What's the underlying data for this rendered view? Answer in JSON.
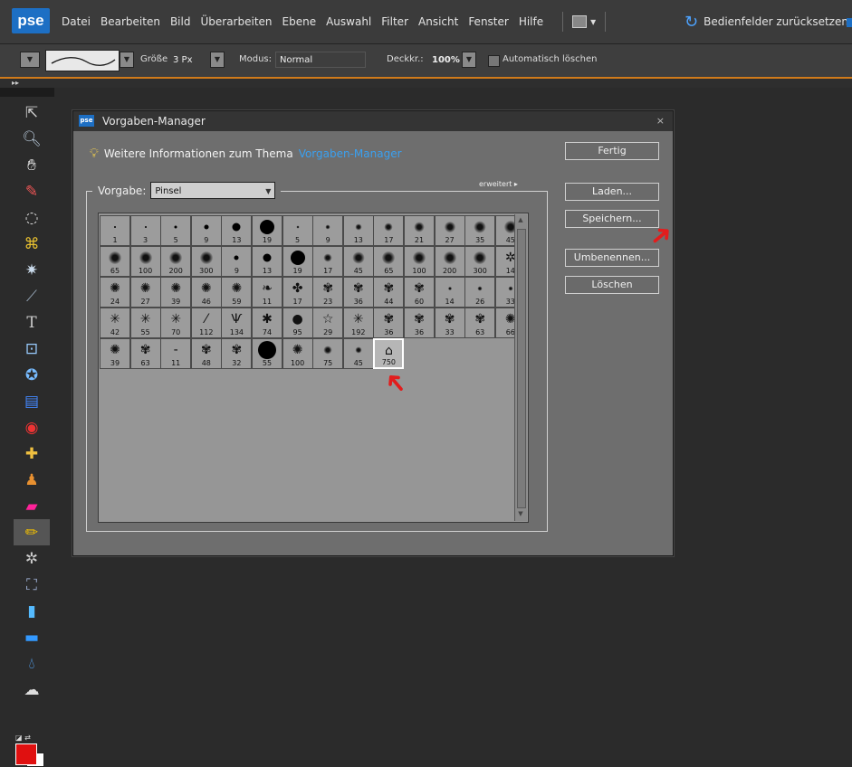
{
  "app": {
    "logo": "pse",
    "menu": [
      "Datei",
      "Bearbeiten",
      "Bild",
      "Überarbeiten",
      "Ebene",
      "Auswahl",
      "Filter",
      "Ansicht",
      "Fenster",
      "Hilfe"
    ],
    "layout_button": "▾",
    "reset_panels": "Bedienfelder zurücksetzen"
  },
  "options": {
    "size_label": "Größe:",
    "size_value": "3 Px",
    "mode_label": "Modus:",
    "mode_value": "Normal",
    "opacity_label": "Deckkr.:",
    "opacity_value": "100%",
    "auto_erase": "Automatisch löschen"
  },
  "panel_strip": {
    "tab": "▸▸"
  },
  "dialog": {
    "title": "Vorgaben-Manager",
    "logo": "pse",
    "close": "×",
    "info_text": "Weitere Informationen zum Thema",
    "info_link": "Vorgaben-Manager",
    "preset_label": "Vorgabe:",
    "preset_value": "Pinsel",
    "advanced": "erweitert ▸",
    "buttons": {
      "done": "Fertig",
      "load": "Laden...",
      "save": "Speichern...",
      "rename": "Umbenennen...",
      "delete": "Löschen"
    },
    "brushes": [
      {
        "size": "1",
        "kind": "dot",
        "d": 2
      },
      {
        "size": "3",
        "kind": "dot",
        "d": 2
      },
      {
        "size": "5",
        "kind": "dot",
        "d": 3
      },
      {
        "size": "9",
        "kind": "dot",
        "d": 5
      },
      {
        "size": "13",
        "kind": "dot",
        "d": 9
      },
      {
        "size": "19",
        "kind": "dot",
        "d": 16
      },
      {
        "size": "5",
        "kind": "soft",
        "d": 3
      },
      {
        "size": "9",
        "kind": "soft",
        "d": 5
      },
      {
        "size": "13",
        "kind": "soft",
        "d": 7
      },
      {
        "size": "17",
        "kind": "soft",
        "d": 9
      },
      {
        "size": "21",
        "kind": "soft",
        "d": 11
      },
      {
        "size": "27",
        "kind": "soft",
        "d": 12
      },
      {
        "size": "35",
        "kind": "soft",
        "d": 13
      },
      {
        "size": "45",
        "kind": "soft",
        "d": 14
      },
      {
        "size": "65",
        "kind": "soft",
        "d": 14
      },
      {
        "size": "100",
        "kind": "soft",
        "d": 14
      },
      {
        "size": "200",
        "kind": "soft",
        "d": 14
      },
      {
        "size": "300",
        "kind": "soft",
        "d": 14
      },
      {
        "size": "9",
        "kind": "dot",
        "d": 5
      },
      {
        "size": "13",
        "kind": "dot",
        "d": 9
      },
      {
        "size": "19",
        "kind": "dot",
        "d": 16
      },
      {
        "size": "17",
        "kind": "soft",
        "d": 9
      },
      {
        "size": "45",
        "kind": "soft",
        "d": 13
      },
      {
        "size": "65",
        "kind": "soft",
        "d": 14
      },
      {
        "size": "100",
        "kind": "soft",
        "d": 14
      },
      {
        "size": "200",
        "kind": "soft",
        "d": 14
      },
      {
        "size": "300",
        "kind": "soft",
        "d": 14
      },
      {
        "size": "14",
        "kind": "glyph",
        "g": "✲"
      },
      {
        "size": "24",
        "kind": "glyph",
        "g": "✺"
      },
      {
        "size": "27",
        "kind": "glyph",
        "g": "✺"
      },
      {
        "size": "39",
        "kind": "glyph",
        "g": "✺"
      },
      {
        "size": "46",
        "kind": "glyph",
        "g": "✺"
      },
      {
        "size": "59",
        "kind": "glyph",
        "g": "✺"
      },
      {
        "size": "11",
        "kind": "glyph",
        "g": "❧"
      },
      {
        "size": "17",
        "kind": "glyph",
        "g": "✤"
      },
      {
        "size": "23",
        "kind": "glyph",
        "g": "✾"
      },
      {
        "size": "36",
        "kind": "glyph",
        "g": "✾"
      },
      {
        "size": "44",
        "kind": "glyph",
        "g": "✾"
      },
      {
        "size": "60",
        "kind": "glyph",
        "g": "✾"
      },
      {
        "size": "14",
        "kind": "soft",
        "d": 4
      },
      {
        "size": "26",
        "kind": "soft",
        "d": 5
      },
      {
        "size": "33",
        "kind": "soft",
        "d": 5
      },
      {
        "size": "42",
        "kind": "glyph",
        "g": "✳"
      },
      {
        "size": "55",
        "kind": "glyph",
        "g": "✳"
      },
      {
        "size": "70",
        "kind": "glyph",
        "g": "✳"
      },
      {
        "size": "112",
        "kind": "glyph",
        "g": "⁄"
      },
      {
        "size": "134",
        "kind": "glyph",
        "g": "Ѱ"
      },
      {
        "size": "74",
        "kind": "glyph",
        "g": "✱"
      },
      {
        "size": "95",
        "kind": "glyph",
        "g": "●"
      },
      {
        "size": "29",
        "kind": "glyph",
        "g": "☆"
      },
      {
        "size": "192",
        "kind": "glyph",
        "g": "✳"
      },
      {
        "size": "36",
        "kind": "glyph",
        "g": "✾"
      },
      {
        "size": "36",
        "kind": "glyph",
        "g": "✾"
      },
      {
        "size": "33",
        "kind": "glyph",
        "g": "✾"
      },
      {
        "size": "63",
        "kind": "glyph",
        "g": "✾"
      },
      {
        "size": "66",
        "kind": "glyph",
        "g": "✺"
      },
      {
        "size": "39",
        "kind": "glyph",
        "g": "✺"
      },
      {
        "size": "63",
        "kind": "glyph",
        "g": "✾"
      },
      {
        "size": "11",
        "kind": "glyph",
        "g": "-"
      },
      {
        "size": "48",
        "kind": "glyph",
        "g": "✾"
      },
      {
        "size": "32",
        "kind": "glyph",
        "g": "✾"
      },
      {
        "size": "55",
        "kind": "dot",
        "d": 20
      },
      {
        "size": "100",
        "kind": "glyph",
        "g": "✺"
      },
      {
        "size": "75",
        "kind": "soft",
        "d": 9
      },
      {
        "size": "45",
        "kind": "soft",
        "d": 7
      },
      {
        "size": "750",
        "kind": "glyph",
        "g": "⌂",
        "selected": true
      }
    ]
  },
  "colors": {
    "foreground": "#e01010",
    "background": "#ffffff",
    "accent": "#1d6fc4",
    "link": "#3aa0f0",
    "annotation_arrow": "#e21d1d"
  }
}
